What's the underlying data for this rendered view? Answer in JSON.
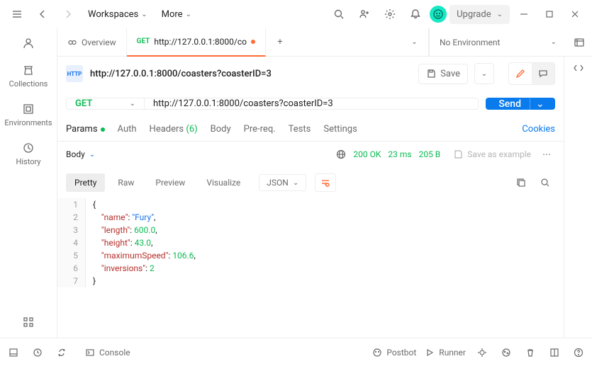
{
  "topbar": {
    "workspaces": "Workspaces",
    "more": "More",
    "upgrade": "Upgrade"
  },
  "sidebar": {
    "collections": "Collections",
    "environments": "Environments",
    "history": "History"
  },
  "tabs": {
    "overview": "Overview",
    "request_method": "GET",
    "request_url_short": "http://127.0.0.1:8000/co",
    "no_env": "No Environment"
  },
  "request": {
    "http_badge": "HTTP",
    "breadcrumb": "http://127.0.0.1:8000/coasters?coasterID=3",
    "save": "Save",
    "method": "GET",
    "url": "http://127.0.0.1:8000/coasters?coasterID=3",
    "send": "Send"
  },
  "reqtabs": {
    "params": "Params",
    "auth": "Auth",
    "headers": "Headers",
    "headers_count": "(6)",
    "body": "Body",
    "prereq": "Pre-req.",
    "tests": "Tests",
    "settings": "Settings",
    "cookies": "Cookies"
  },
  "response": {
    "body": "Body",
    "status": "200 OK",
    "time": "23 ms",
    "size": "205 B",
    "save_example": "Save as example"
  },
  "viewtabs": {
    "pretty": "Pretty",
    "raw": "Raw",
    "preview": "Preview",
    "visualize": "Visualize",
    "json": "JSON"
  },
  "code": {
    "l1": "{",
    "l2_key": "\"name\"",
    "l2_val": "\"Fury\"",
    "l3_key": "\"length\"",
    "l3_val": "600.0",
    "l4_key": "\"height\"",
    "l4_val": "43.0",
    "l5_key": "\"maximumSpeed\"",
    "l5_val": "106.6",
    "l6_key": "\"inversions\"",
    "l6_val": "2",
    "l7": "}"
  },
  "footer": {
    "console": "Console",
    "postbot": "Postbot",
    "runner": "Runner"
  }
}
